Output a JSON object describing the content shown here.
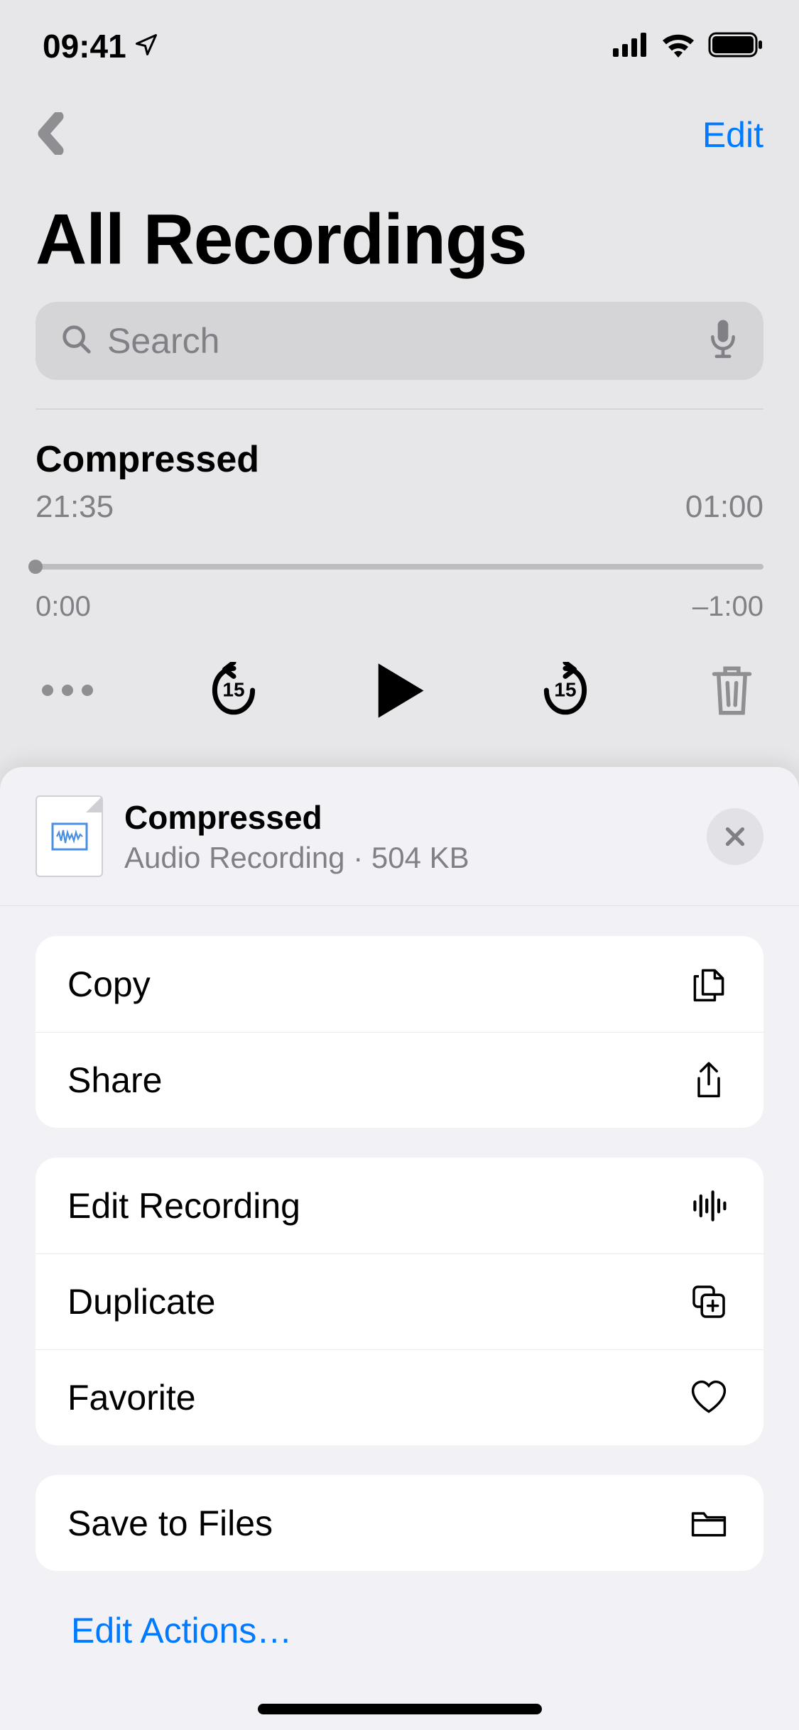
{
  "status": {
    "time": "09:41"
  },
  "nav": {
    "edit": "Edit"
  },
  "title": "All Recordings",
  "search": {
    "placeholder": "Search"
  },
  "recording": {
    "name": "Compressed",
    "time": "21:35",
    "duration": "01:00",
    "scrub_start": "0:00",
    "scrub_end": "–1:00"
  },
  "sheet": {
    "file_name": "Compressed",
    "file_type": "Audio Recording",
    "file_size": "504 KB",
    "groups": [
      [
        {
          "label": "Copy",
          "icon": "copy"
        },
        {
          "label": "Share",
          "icon": "share"
        }
      ],
      [
        {
          "label": "Edit Recording",
          "icon": "waveform"
        },
        {
          "label": "Duplicate",
          "icon": "duplicate"
        },
        {
          "label": "Favorite",
          "icon": "heart"
        }
      ],
      [
        {
          "label": "Save to Files",
          "icon": "folder"
        }
      ]
    ],
    "edit_actions": "Edit Actions…"
  }
}
